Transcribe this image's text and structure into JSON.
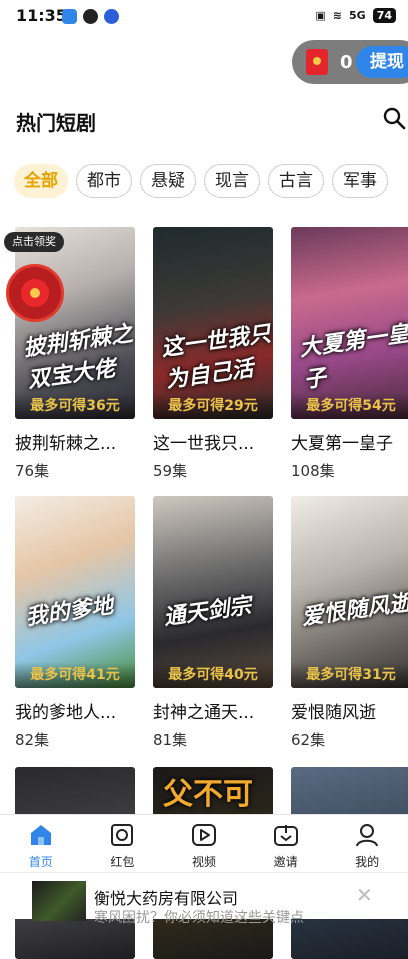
{
  "status_bar": {
    "time": "11:35",
    "network": "5G",
    "battery": "74"
  },
  "reward": {
    "coins": "0",
    "withdraw_label": "提现"
  },
  "header": {
    "title": "热门短剧"
  },
  "categories": [
    "全部",
    "都市",
    "悬疑",
    "现言",
    "古言",
    "军事"
  ],
  "cards": [
    {
      "poster_text": "披荆斩棘之双宝大佬",
      "reward": "最多可得36元",
      "title": "披荆斩棘之...",
      "episodes": "76集"
    },
    {
      "poster_text": "这一世我只为自己活",
      "reward": "最多可得29元",
      "title": "这一世我只...",
      "episodes": "59集"
    },
    {
      "poster_text": "大夏第一皇子",
      "reward": "最多可得54元",
      "title": "大夏第一皇子",
      "episodes": "108集"
    },
    {
      "poster_text": "我的爹地",
      "reward": "最多可得41元",
      "title": "我的爹地人...",
      "episodes": "82集"
    },
    {
      "poster_text": "通天剑宗",
      "reward": "最多可得40元",
      "title": "封神之通天...",
      "episodes": "81集"
    },
    {
      "poster_text": "爱恨随风逝",
      "reward": "最多可得31元",
      "title": "爱恨随风逝",
      "episodes": "62集"
    },
    {
      "poster_text": "",
      "reward": "",
      "title": "",
      "episodes": ""
    },
    {
      "poster_text": "父不可失",
      "reward": "",
      "title": "",
      "episodes": ""
    },
    {
      "poster_text": "",
      "reward": "",
      "title": "",
      "episodes": ""
    }
  ],
  "tap_tag": "点击领奖",
  "nav": [
    {
      "label": "首页",
      "icon": "home-icon"
    },
    {
      "label": "红包",
      "icon": "red-packet-icon"
    },
    {
      "label": "视频",
      "icon": "video-icon"
    },
    {
      "label": "邀请",
      "icon": "invite-icon"
    },
    {
      "label": "我的",
      "icon": "profile-icon"
    }
  ],
  "ad": {
    "title": "衡悦大药房有限公司",
    "subtitle": "寒风困扰？你必须知道这些关键点"
  },
  "colors": {
    "accent": "#2f86e8",
    "chip_active_bg": "#fdf2d3",
    "chip_active_text": "#e8a300",
    "reward_gold": "#e9c24a"
  }
}
